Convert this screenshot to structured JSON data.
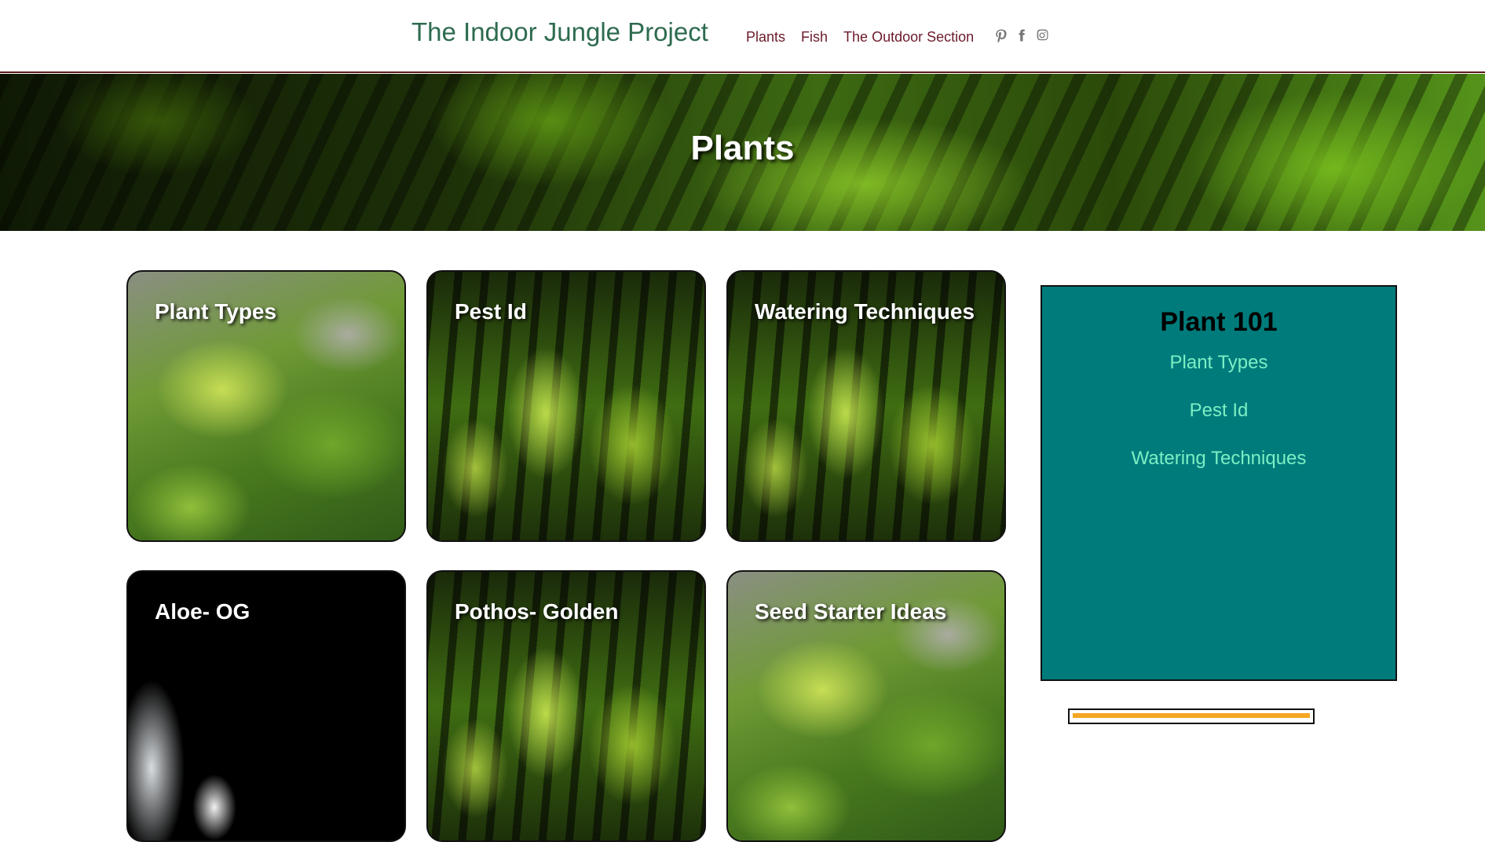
{
  "header": {
    "site_title": "The Indoor Jungle Project",
    "nav": [
      "Plants",
      "Fish",
      "The Outdoor Section"
    ],
    "social_icons": [
      "pinterest-icon",
      "facebook-icon",
      "instagram-icon"
    ]
  },
  "hero": {
    "title": "Plants"
  },
  "cards": [
    {
      "label": "Plant Types"
    },
    {
      "label": "Pest Id"
    },
    {
      "label": "Watering Techniques"
    },
    {
      "label": "Aloe- OG"
    },
    {
      "label": "Pothos- Golden"
    },
    {
      "label": "Seed Starter Ideas"
    }
  ],
  "sidebar": {
    "title": "Plant 101",
    "links": [
      "Plant Types",
      "Pest Id",
      "Watering Techniques"
    ]
  },
  "colors": {
    "title_green": "#2e6b4f",
    "nav_maroon": "#6b1a2a",
    "sidebar_teal": "#007b7b",
    "sidebar_link": "#7af0c4",
    "widget_accent": "#f5a623"
  }
}
